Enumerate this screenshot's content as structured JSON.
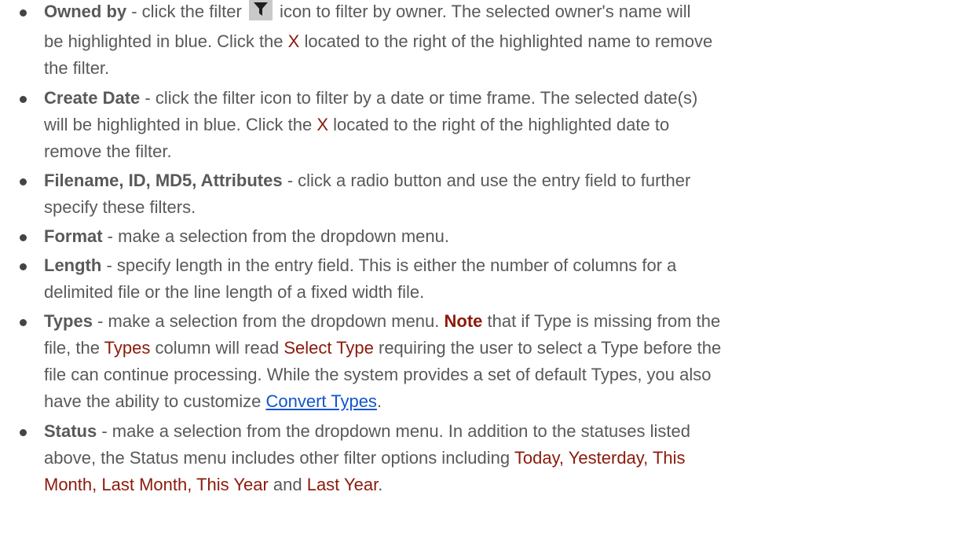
{
  "items": [
    {
      "term": "Owned by",
      "lines": [
        [
          "",
          "",
          " - click the  filter "
        ],
        [
          "",
          "",
          " icon to filter by owner.  The selected owner's name will"
        ],
        [
          "be highlighted in blue. Click the ",
          "X",
          " located to the right of the highlighted name to remove"
        ],
        [
          "the filter.",
          "",
          ""
        ]
      ]
    },
    {
      "term": "Create Date",
      "lines": [
        [
          " - click the filter icon to filter by a date or time frame. The selected date(s)",
          "",
          ""
        ],
        [
          "will be highlighted in blue. Click the ",
          "X",
          " located to the right of the highlighted date to"
        ],
        [
          "remove the filter.",
          "",
          ""
        ]
      ]
    },
    {
      "term": "Filename, ID, MD5, Attributes",
      "lines": [
        [
          " - click a radio button and use the entry field to further",
          "",
          ""
        ],
        [
          "specify these filters.",
          "",
          ""
        ]
      ]
    },
    {
      "term": "Format",
      "lines": [
        [
          " - make a selection from the dropdown menu.",
          "",
          ""
        ]
      ]
    },
    {
      "term": "Length",
      "lines": [
        [
          " - specify length in the entry field. This is either the number of columns for a",
          "",
          ""
        ],
        [
          "delimited file or the line length of a fixed width file.",
          "",
          ""
        ]
      ]
    },
    {
      "term": "Types",
      "lines": [
        [
          " - make a selection from the dropdown menu. ",
          "Note",
          " that if Type is missing from the"
        ],
        [
          "file, the ",
          "Types",
          " column will read "
        ],
        [
          "",
          "Select Type",
          " requiring the user to select a Type before the"
        ],
        [
          "file can continue processing. While the system provides a set of default Types, you also",
          "",
          ""
        ],
        [
          "have the ability to customize ",
          "Convert Types",
          "."
        ]
      ]
    },
    {
      "term": "Status",
      "lines": [
        [
          " - make a selection from the dropdown menu.  In addition to the statuses listed",
          "",
          ""
        ],
        [
          "above, the Status menu includes other filter options including ",
          "Today, Yesterday, This",
          ""
        ],
        [
          "Month, Last Month, This Year",
          " and ",
          "Last Year"
        ],
        [
          ".",
          "",
          ""
        ]
      ]
    }
  ],
  "icons": {
    "filter": "funnel-filter-icon"
  },
  "colors": {
    "body_text": "#595959",
    "highlight": "#8b1a0a",
    "link": "#1155cc",
    "icon_bg": "#c9c9c9"
  }
}
